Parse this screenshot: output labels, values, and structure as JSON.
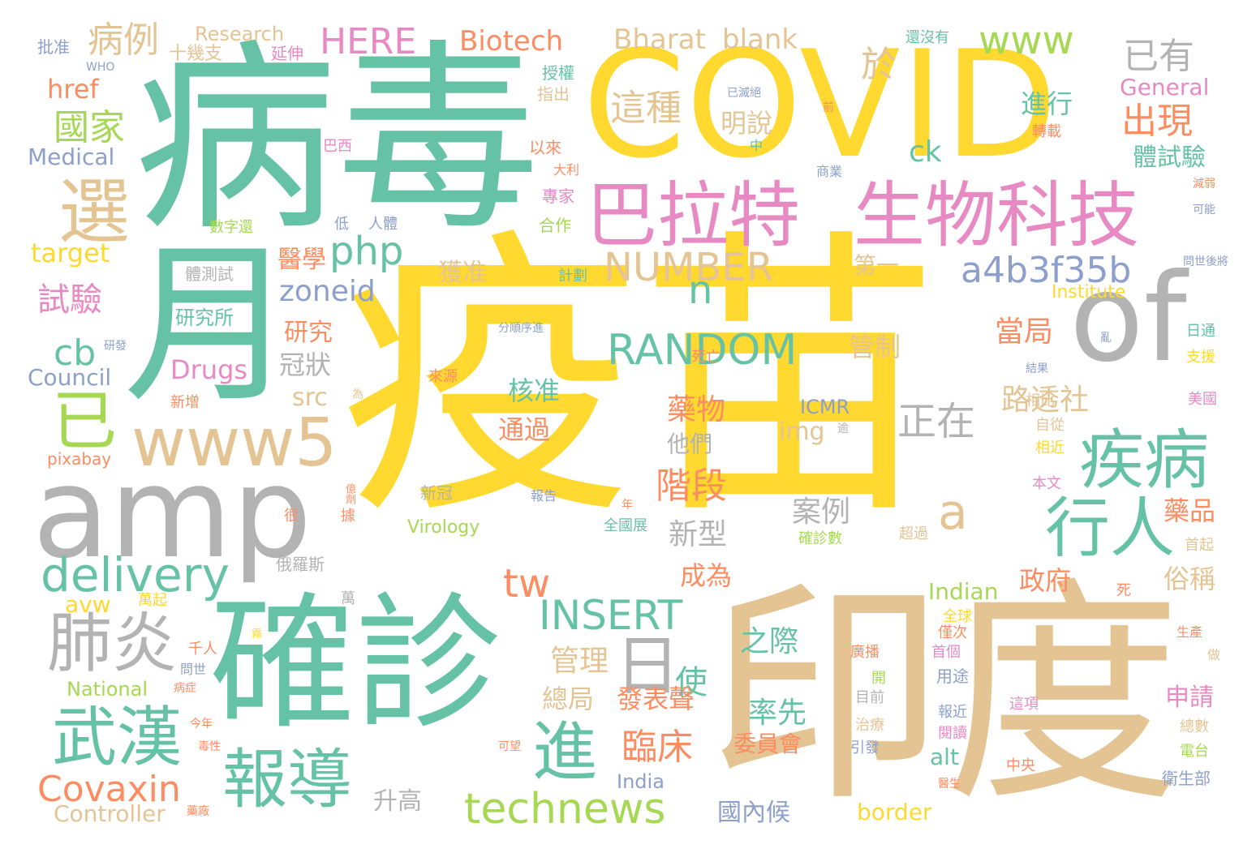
{
  "palette": {
    "teal": "#66c2a5",
    "yellow": "#ffd92f",
    "tan": "#e5c494",
    "gray": "#b3b3b3",
    "pink": "#e78ac3",
    "green": "#a6d854",
    "orange": "#fc8d62",
    "blue": "#8da0cb"
  },
  "words": [
    {
      "text": "疫苗",
      "color": "yellow"
    },
    {
      "text": "病毒",
      "color": "teal"
    },
    {
      "text": "COVID",
      "color": "yellow"
    },
    {
      "text": "印度",
      "color": "tan"
    },
    {
      "text": "確診",
      "color": "teal"
    },
    {
      "text": "月",
      "color": "teal"
    },
    {
      "text": "amp",
      "color": "gray"
    },
    {
      "text": "of",
      "color": "gray"
    },
    {
      "text": "巴拉特",
      "color": "pink"
    },
    {
      "text": "生物科技",
      "color": "pink"
    },
    {
      "text": "www5",
      "color": "tan"
    },
    {
      "text": "選",
      "color": "tan"
    },
    {
      "text": "已",
      "color": "green"
    },
    {
      "text": "疾病",
      "color": "teal"
    },
    {
      "text": "行人",
      "color": "teal"
    },
    {
      "text": "肺炎",
      "color": "gray"
    },
    {
      "text": "武漢",
      "color": "teal"
    },
    {
      "text": "報導",
      "color": "teal"
    },
    {
      "text": "進",
      "color": "teal"
    },
    {
      "text": "technews",
      "color": "green"
    },
    {
      "text": "delivery",
      "color": "teal"
    },
    {
      "text": "Covaxin",
      "color": "orange"
    },
    {
      "text": "RANDOM",
      "color": "teal"
    },
    {
      "text": "NUMBER",
      "color": "tan"
    },
    {
      "text": "INSERT",
      "color": "teal"
    },
    {
      "text": "a4b3f35b",
      "color": "blue"
    },
    {
      "text": "php",
      "color": "teal"
    },
    {
      "text": "HERE",
      "color": "pink"
    },
    {
      "text": "Biotech",
      "color": "orange"
    },
    {
      "text": "Bharat",
      "color": "tan"
    },
    {
      "text": "blank",
      "color": "tan"
    },
    {
      "text": "www",
      "color": "green"
    },
    {
      "text": "已有",
      "color": "gray"
    },
    {
      "text": "病例",
      "color": "tan"
    },
    {
      "text": "國家",
      "color": "green"
    },
    {
      "text": "這種",
      "color": "tan"
    },
    {
      "text": "於",
      "color": "tan"
    },
    {
      "text": "出現",
      "color": "orange"
    },
    {
      "text": "進行",
      "color": "teal"
    },
    {
      "text": "明說",
      "color": "tan"
    },
    {
      "text": "體試驗",
      "color": "teal"
    },
    {
      "text": "日",
      "color": "gray"
    },
    {
      "text": "tw",
      "color": "orange"
    },
    {
      "text": "正在",
      "color": "gray"
    },
    {
      "text": "a",
      "color": "tan"
    },
    {
      "text": "n",
      "color": "teal"
    },
    {
      "text": "cb",
      "color": "teal"
    },
    {
      "text": "ck",
      "color": "teal"
    },
    {
      "text": "zoneid",
      "color": "blue"
    },
    {
      "text": "target",
      "color": "yellow"
    },
    {
      "text": "href",
      "color": "orange"
    },
    {
      "text": "Medical",
      "color": "blue"
    },
    {
      "text": "Council",
      "color": "blue"
    },
    {
      "text": "Drugs",
      "color": "pink"
    },
    {
      "text": "General",
      "color": "pink"
    },
    {
      "text": "Institute",
      "color": "yellow"
    },
    {
      "text": "Research",
      "color": "tan"
    },
    {
      "text": "Controller",
      "color": "tan"
    },
    {
      "text": "National",
      "color": "green"
    },
    {
      "text": "Indian",
      "color": "green"
    },
    {
      "text": "India",
      "color": "blue"
    },
    {
      "text": "Virology",
      "color": "green"
    },
    {
      "text": "ICMR",
      "color": "blue"
    },
    {
      "text": "pixabay",
      "color": "orange"
    },
    {
      "text": "WHO",
      "color": "blue"
    },
    {
      "text": "avw",
      "color": "yellow"
    },
    {
      "text": "src",
      "color": "tan"
    },
    {
      "text": "img",
      "color": "tan"
    },
    {
      "text": "alt",
      "color": "teal"
    },
    {
      "text": "border",
      "color": "yellow"
    },
    {
      "text": "試驗",
      "color": "pink"
    },
    {
      "text": "醫學",
      "color": "orange"
    },
    {
      "text": "研究",
      "color": "orange"
    },
    {
      "text": "冠狀",
      "color": "gray"
    },
    {
      "text": "獲准",
      "color": "tan"
    },
    {
      "text": "管制",
      "color": "tan"
    },
    {
      "text": "第一",
      "color": "tan"
    },
    {
      "text": "當局",
      "color": "orange"
    },
    {
      "text": "路透社",
      "color": "tan"
    },
    {
      "text": "藥物",
      "color": "orange"
    },
    {
      "text": "核准",
      "color": "teal"
    },
    {
      "text": "通過",
      "color": "orange"
    },
    {
      "text": "他們",
      "color": "gray"
    },
    {
      "text": "階段",
      "color": "orange"
    },
    {
      "text": "案例",
      "color": "gray"
    },
    {
      "text": "新型",
      "color": "gray"
    },
    {
      "text": "成為",
      "color": "orange"
    },
    {
      "text": "政府",
      "color": "orange"
    },
    {
      "text": "藥品",
      "color": "orange"
    },
    {
      "text": "俗稱",
      "color": "tan"
    },
    {
      "text": "管理",
      "color": "tan"
    },
    {
      "text": "總局",
      "color": "tan"
    },
    {
      "text": "使",
      "color": "teal"
    },
    {
      "text": "發表聲",
      "color": "orange"
    },
    {
      "text": "臨床",
      "color": "orange"
    },
    {
      "text": "之際",
      "color": "teal"
    },
    {
      "text": "率先",
      "color": "teal"
    },
    {
      "text": "委員會",
      "color": "orange"
    },
    {
      "text": "國內候",
      "color": "blue"
    },
    {
      "text": "升高",
      "color": "gray"
    },
    {
      "text": "申請",
      "color": "pink"
    },
    {
      "text": "研究所",
      "color": "teal"
    },
    {
      "text": "體測試",
      "color": "gray"
    },
    {
      "text": "十幾支",
      "color": "tan"
    },
    {
      "text": "批准",
      "color": "blue"
    },
    {
      "text": "延伸",
      "color": "pink"
    },
    {
      "text": "授權",
      "color": "teal"
    },
    {
      "text": "指出",
      "color": "tan"
    },
    {
      "text": "以來",
      "color": "orange"
    },
    {
      "text": "大利",
      "color": "orange"
    },
    {
      "text": "專家",
      "color": "pink"
    },
    {
      "text": "合作",
      "color": "green"
    },
    {
      "text": "巴西",
      "color": "pink"
    },
    {
      "text": "低",
      "color": "blue"
    },
    {
      "text": "人體",
      "color": "blue"
    },
    {
      "text": "數字還",
      "color": "green"
    },
    {
      "text": "計劃",
      "color": "teal"
    },
    {
      "text": "分順序進",
      "color": "blue"
    },
    {
      "text": "還沒有",
      "color": "teal"
    },
    {
      "text": "已滅絕",
      "color": "blue"
    },
    {
      "text": "前",
      "color": "orange"
    },
    {
      "text": "中",
      "color": "teal"
    },
    {
      "text": "轉載",
      "color": "orange"
    },
    {
      "text": "商業",
      "color": "blue"
    },
    {
      "text": "減弱",
      "color": "orange"
    },
    {
      "text": "可能",
      "color": "blue"
    },
    {
      "text": "問世後將",
      "color": "blue"
    },
    {
      "text": "日通",
      "color": "teal"
    },
    {
      "text": "支援",
      "color": "yellow"
    },
    {
      "text": "亂",
      "color": "blue"
    },
    {
      "text": "結果",
      "color": "blue"
    },
    {
      "text": "相比",
      "color": "tan"
    },
    {
      "text": "自從",
      "color": "tan"
    },
    {
      "text": "相近",
      "color": "yellow"
    },
    {
      "text": "美國",
      "color": "pink"
    },
    {
      "text": "本文",
      "color": "pink"
    },
    {
      "text": "首起",
      "color": "tan"
    },
    {
      "text": "死",
      "color": "orange"
    },
    {
      "text": "生產",
      "color": "orange"
    },
    {
      "text": "做",
      "color": "tan"
    },
    {
      "text": "總數",
      "color": "tan"
    },
    {
      "text": "電台",
      "color": "green"
    },
    {
      "text": "衛生部",
      "color": "blue"
    },
    {
      "text": "中央",
      "color": "orange"
    },
    {
      "text": "醫生",
      "color": "orange"
    },
    {
      "text": "這項",
      "color": "pink"
    },
    {
      "text": "報近",
      "color": "blue"
    },
    {
      "text": "閱讀",
      "color": "pink"
    },
    {
      "text": "確診數",
      "color": "green"
    },
    {
      "text": "超過",
      "color": "tan"
    },
    {
      "text": "全國展",
      "color": "teal"
    },
    {
      "text": "年",
      "color": "orange"
    },
    {
      "text": "報告",
      "color": "blue"
    },
    {
      "text": "新冠",
      "color": "gray"
    },
    {
      "text": "很",
      "color": "orange"
    },
    {
      "text": "據",
      "color": "orange"
    },
    {
      "text": "俄羅斯",
      "color": "gray"
    },
    {
      "text": "萬",
      "color": "gray"
    },
    {
      "text": "萬起",
      "color": "yellow"
    },
    {
      "text": "千人",
      "color": "orange"
    },
    {
      "text": "問世",
      "color": "blue"
    },
    {
      "text": "廣播",
      "color": "orange"
    },
    {
      "text": "首個",
      "color": "pink"
    },
    {
      "text": "用途",
      "color": "blue"
    },
    {
      "text": "全球",
      "color": "yellow"
    },
    {
      "text": "僅次",
      "color": "orange"
    },
    {
      "text": "開",
      "color": "green"
    },
    {
      "text": "目前",
      "color": "gray"
    },
    {
      "text": "治療",
      "color": "tan"
    },
    {
      "text": "引發",
      "color": "blue"
    },
    {
      "text": "今年",
      "color": "orange"
    },
    {
      "text": "毒性",
      "color": "orange"
    },
    {
      "text": "可望",
      "color": "orange"
    },
    {
      "text": "藥廠",
      "color": "orange"
    },
    {
      "text": "病症",
      "color": "orange"
    },
    {
      "text": "新增",
      "color": "orange"
    },
    {
      "text": "來源",
      "color": "orange"
    },
    {
      "text": "死亡",
      "color": "orange"
    },
    {
      "text": "為",
      "color": "tan"
    },
    {
      "text": "研發",
      "color": "blue"
    },
    {
      "text": "億劑",
      "color": "orange"
    },
    {
      "text": "逾",
      "color": "gray"
    },
    {
      "text": "霧",
      "color": "yellow"
    }
  ]
}
